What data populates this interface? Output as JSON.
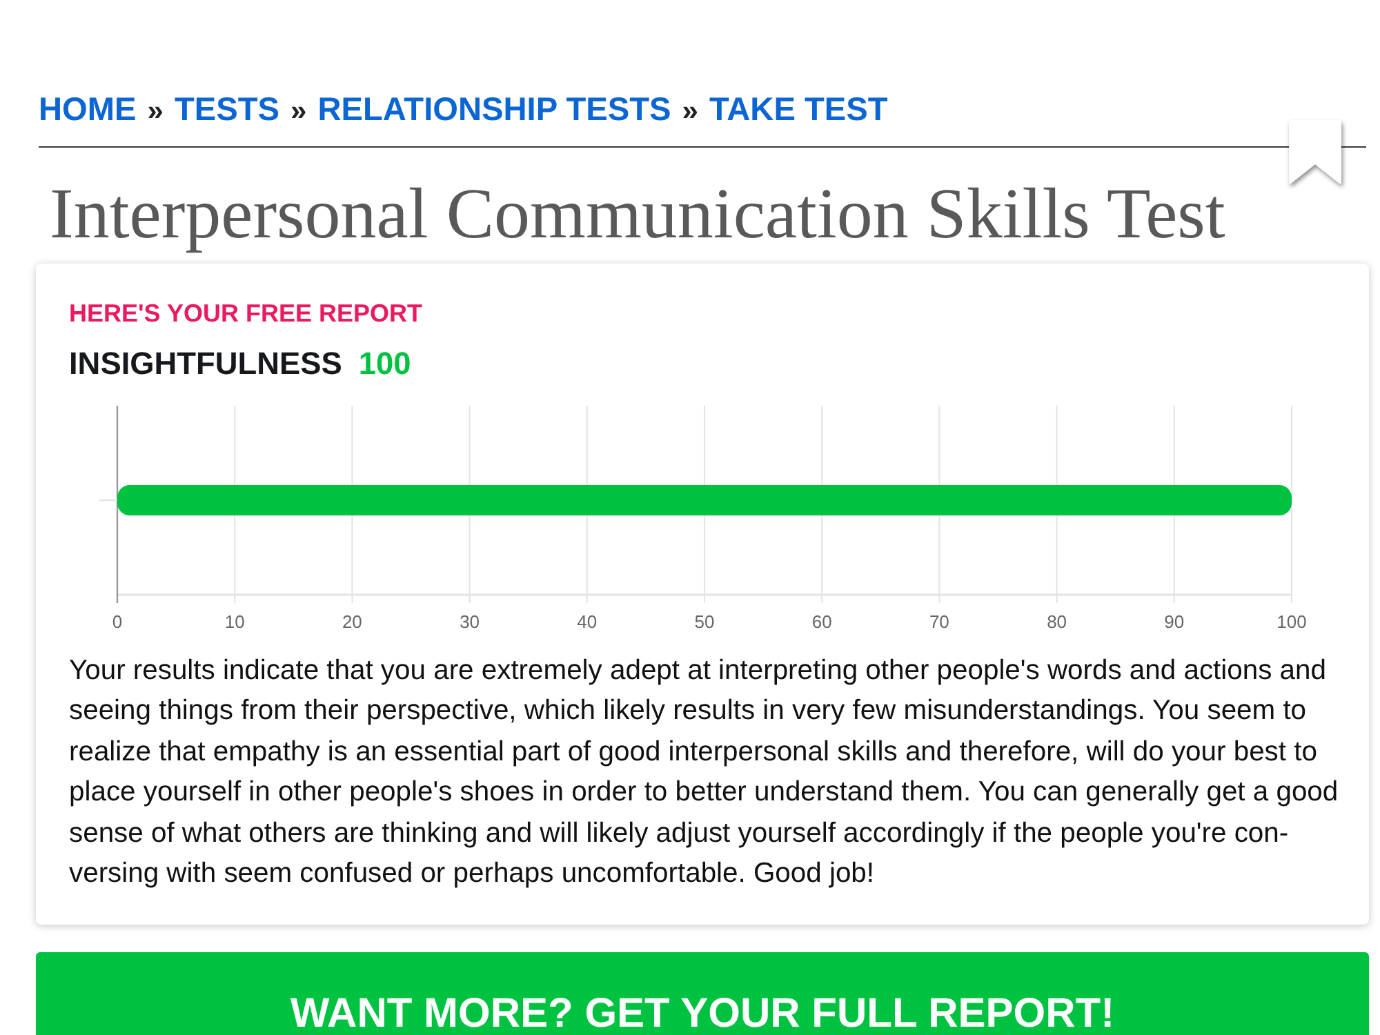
{
  "breadcrumb": [
    {
      "kind": "link",
      "text": "HOME"
    },
    {
      "kind": "separator",
      "text": "»"
    },
    {
      "kind": "link",
      "text": "TESTS"
    },
    {
      "kind": "separator",
      "text": "»"
    },
    {
      "kind": "link",
      "text": "RELATIONSHIP TESTS"
    },
    {
      "kind": "separator",
      "text": "»"
    },
    {
      "kind": "link",
      "text": "TAKE TEST"
    }
  ],
  "title": "Interpersonal Communication Skills Test",
  "report": {
    "kicker": "HERE'S YOUR FREE REPORT",
    "trait": "INSIGHTFULNESS",
    "score": "100",
    "chart_data": {
      "type": "bar",
      "orientation": "horizontal",
      "values": [
        100
      ],
      "xlim": [
        0,
        100
      ],
      "xticks": [
        0,
        10,
        20,
        30,
        40,
        50,
        60,
        70,
        80,
        90,
        100
      ],
      "grid": true
    },
    "text": "Your results indicate that you are extremely adept at interpreting other people's words and actions and seeing things from their perspective, which likely results in very few misunderstandings. You seem to realize that empathy is an essential part of good interpersonal skills and therefore, will do your best to place yourself in other people's shoes in order to better understand them. You can generally get a good sense of what others are thinking and will likely adjust yourself accordingly if the people you're con-versing with seem confused or perhaps uncomfortable. Good job!"
  },
  "cta": "WANT MORE? GET YOUR FULL REPORT!"
}
